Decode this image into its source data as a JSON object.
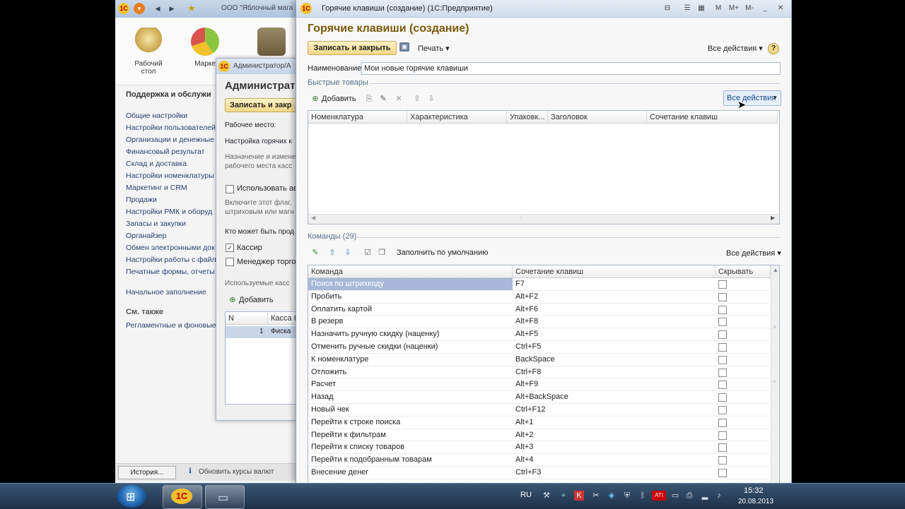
{
  "main_window": {
    "title_fragment": "ООО \"Яблочный мага",
    "ribbon": [
      {
        "label": "Рабочий\nстол"
      },
      {
        "label": "Марке"
      }
    ],
    "sidebar": {
      "heading": "Поддержка и обслужи",
      "links": [
        "Общие настройки",
        "Настройки пользователей",
        "Организации и денежные",
        "Финансовый результат",
        "Склад и доставка",
        "Настройки номенклатуры",
        "Маркетинг и CRM",
        "Продажи",
        "Настройки РМК и оборуд",
        "Запасы и закупки",
        "Органайзер",
        "Обмен электронными док",
        "Настройки работы с файл",
        "Печатные формы, отчеты"
      ],
      "initial": "Начальное заполнение",
      "see_also": "См. также",
      "see_also_link": "Регламентные и фоновые"
    },
    "status": {
      "history": "История...",
      "rates": "Обновить курсы валют"
    }
  },
  "admin_window": {
    "title": "Администратор/А",
    "heading": "Администрат",
    "save_btn": "Записать и закр",
    "workplace_label": "Рабочее место:",
    "workplace_value": "Настройка горячих к",
    "desc": "Назначение и измене\nрабочего места касс",
    "use_auto": "Использовать авт",
    "hint": "Включите этот флаг,\nштриховым или магн",
    "who_can": "Кто может быть прод",
    "cashier": "Кассир",
    "manager": "Менеджер торгов",
    "registers": "Используемые касс",
    "add": "Добавить",
    "col_n": "N",
    "col_kassa": "Касса К",
    "row_n": "1",
    "row_kassa": "Фиска"
  },
  "dialog": {
    "window_title": "Горячие клавиши (создание)  (1С:Предприятие)",
    "window_buttons": [
      "M",
      "M+",
      "M-"
    ],
    "heading": "Горячие клавиши (создание)",
    "save_close": "Записать и закрыть",
    "print": "Печать",
    "all_actions": "Все действия",
    "name_label": "Наименование:",
    "name_value": "Мои новые горячие клавиши",
    "quick_goods": {
      "title": "Быстрые товары",
      "add": "Добавить",
      "all_actions": "Все действия",
      "columns": [
        "Номенклатура",
        "Характеристика",
        "Упаковк...",
        "Заголовок",
        "Сочетание клавиш"
      ]
    },
    "commands": {
      "title": "Команды (29)",
      "fill_default": "Заполнить по умолчанию",
      "all_actions": "Все действия",
      "columns": [
        "Команда",
        "Сочетание клавиш",
        "Скрывать"
      ],
      "rows": [
        {
          "cmd": "Поиск по штрихкоду",
          "key": "F7"
        },
        {
          "cmd": "Пробить",
          "key": "Alt+F2"
        },
        {
          "cmd": "Оплатить картой",
          "key": "Alt+F6"
        },
        {
          "cmd": "В резерв",
          "key": "Alt+F8"
        },
        {
          "cmd": "Назначить ручную скидку (наценку)",
          "key": "Alt+F5"
        },
        {
          "cmd": "Отменить ручные скидки (наценки)",
          "key": "Ctrl+F5"
        },
        {
          "cmd": "К номенклатуре",
          "key": "BackSpace"
        },
        {
          "cmd": "Отложить",
          "key": "Ctrl+F8"
        },
        {
          "cmd": "Расчет",
          "key": "Alt+F9"
        },
        {
          "cmd": "Назад",
          "key": "Alt+BackSpace"
        },
        {
          "cmd": "Новый чек",
          "key": "Ctrl+F12"
        },
        {
          "cmd": "Перейти к строке поиска",
          "key": "Alt+1"
        },
        {
          "cmd": "Перейти к фильтрам",
          "key": "Alt+2"
        },
        {
          "cmd": "Перейти к списку товаров",
          "key": "Alt+3"
        },
        {
          "cmd": "Перейти к подобранным товарам",
          "key": "Alt+4"
        },
        {
          "cmd": "Внесение денег",
          "key": "Ctrl+F3"
        }
      ]
    }
  },
  "taskbar": {
    "lang": "RU",
    "time": "15:32",
    "date": "20.08.2013",
    "onec_label": "1С"
  },
  "colors": {
    "accent_yellow": "#f3d88a",
    "selected_row": "#a8b8d8",
    "heading_brown": "#7a5a0a"
  }
}
